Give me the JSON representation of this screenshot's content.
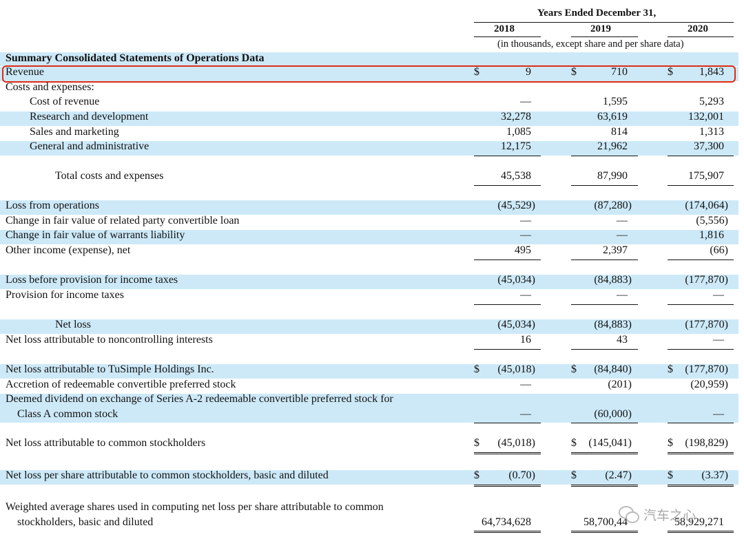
{
  "header": {
    "period": "Years Ended December 31,",
    "years": [
      "2018",
      "2019",
      "2020"
    ],
    "unit_note": "(in thousands, except share and per share data)"
  },
  "section_title": "Summary Consolidated Statements of Operations Data",
  "currency_symbol": "$",
  "highlight_color": "#e02a14",
  "band_color": "#cde9f8",
  "rows": [
    {
      "id": "revenue",
      "label": [
        "Revenue"
      ],
      "values": [
        "9",
        "710",
        "1,843"
      ],
      "dollar": true,
      "band": true,
      "highlight": true
    },
    {
      "id": "costs-header",
      "label": [
        "Costs and expenses:"
      ],
      "values": [
        "",
        "",
        ""
      ],
      "band": false
    },
    {
      "id": "cost-of-revenue",
      "label": [
        "Cost of revenue"
      ],
      "values": [
        "—",
        "1,595",
        "5,293"
      ],
      "indent": 1,
      "band": false
    },
    {
      "id": "rnd",
      "label": [
        "Research and development"
      ],
      "values": [
        "32,278",
        "63,619",
        "132,001"
      ],
      "indent": 1,
      "band": true
    },
    {
      "id": "sales-marketing",
      "label": [
        "Sales and marketing"
      ],
      "values": [
        "1,085",
        "814",
        "1,313"
      ],
      "indent": 1,
      "band": false
    },
    {
      "id": "gna",
      "label": [
        "General and administrative"
      ],
      "values": [
        "12,175",
        "21,962",
        "37,300"
      ],
      "indent": 1,
      "band": true,
      "underline": "single"
    },
    {
      "id": "total-costs",
      "label": [
        "Total costs and expenses"
      ],
      "values": [
        "45,538",
        "87,990",
        "175,907"
      ],
      "indent": 2,
      "band": false,
      "underline": "single"
    },
    {
      "id": "loss-from-operations",
      "label": [
        "Loss from operations"
      ],
      "values": [
        "(45,529)",
        "(87,280)",
        "(174,064)"
      ],
      "band": true
    },
    {
      "id": "fv-convertible-loan",
      "label": [
        "Change in fair value of related party convertible loan"
      ],
      "values": [
        "—",
        "—",
        "(5,556)"
      ],
      "band": false
    },
    {
      "id": "fv-warrants",
      "label": [
        "Change in fair value of warrants liability"
      ],
      "values": [
        "—",
        "—",
        "1,816"
      ],
      "band": true
    },
    {
      "id": "other-income",
      "label": [
        "Other income (expense), net"
      ],
      "values": [
        "495",
        "2,397",
        "(66)"
      ],
      "band": false,
      "underline": "single"
    },
    {
      "id": "loss-before-tax",
      "label": [
        "Loss before provision for income taxes"
      ],
      "values": [
        "(45,034)",
        "(84,883)",
        "(177,870)"
      ],
      "band": true
    },
    {
      "id": "provision-tax",
      "label": [
        "Provision for income taxes"
      ],
      "values": [
        "—",
        "—",
        "—"
      ],
      "band": false,
      "underline": "single"
    },
    {
      "id": "net-loss",
      "label": [
        "Net loss"
      ],
      "values": [
        "(45,034)",
        "(84,883)",
        "(177,870)"
      ],
      "indent": 2,
      "band": true
    },
    {
      "id": "nci",
      "label": [
        "Net loss attributable to noncontrolling interests"
      ],
      "values": [
        "16",
        "43",
        "—"
      ],
      "band": false,
      "underline": "single"
    },
    {
      "id": "net-loss-tusimple",
      "label": [
        "Net loss attributable to TuSimple Holdings Inc."
      ],
      "values": [
        "(45,018)",
        "(84,840)",
        "(177,870)"
      ],
      "dollar": true,
      "band": true
    },
    {
      "id": "accretion",
      "label": [
        "Accretion of redeemable convertible preferred stock"
      ],
      "values": [
        "—",
        "(201)",
        "(20,959)"
      ],
      "band": false
    },
    {
      "id": "deemed-dividend",
      "label": [
        "Deemed dividend on exchange of Series A-2 redeemable convertible preferred stock for",
        "Class A common stock"
      ],
      "values": [
        "—",
        "(60,000)",
        "—"
      ],
      "band": true,
      "underline": "single"
    },
    {
      "id": "net-loss-common",
      "label": [
        "Net loss attributable to common stockholders"
      ],
      "values": [
        "(45,018)",
        "(145,041)",
        "(198,829)"
      ],
      "dollar": true,
      "band": false,
      "underline": "double"
    },
    {
      "id": "eps",
      "label": [
        "Net loss per share attributable to common stockholders, basic and diluted"
      ],
      "values": [
        "(0.70)",
        "(2.47)",
        "(3.37)"
      ],
      "dollar": true,
      "band": true,
      "underline": "double"
    },
    {
      "id": "weighted-shares",
      "label": [
        "Weighted average shares used in computing net loss per share attributable to common",
        "stockholders, basic and diluted"
      ],
      "values": [
        "64,734,628",
        "58,700,44",
        "58,929,271"
      ],
      "band": false,
      "underline": "double"
    }
  ],
  "watermark": {
    "text": "汽车之心",
    "icon": "wechat-icon"
  }
}
